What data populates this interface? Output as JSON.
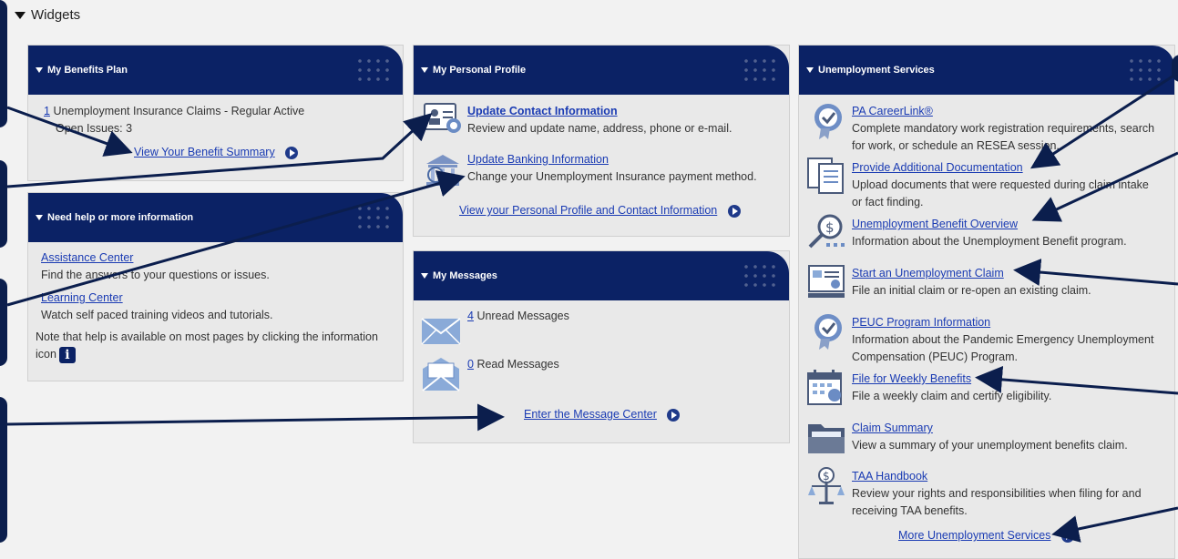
{
  "widgets_title": "Widgets",
  "benefits": {
    "title": "My Benefits Plan",
    "claim_count": "1",
    "claim_text": "Unemployment Insurance Claims - Regular Active",
    "open_issues": "Open Issues: 3",
    "summary_link": "View Your Benefit Summary"
  },
  "help": {
    "title": "Need help or more information",
    "assist_link": "Assistance Center",
    "assist_desc": "Find the answers to your questions or issues.",
    "learn_link": "Learning Center",
    "learn_desc": "Watch self paced training videos and tutorials.",
    "note_line1": "Note that help is available on most pages by clicking the information",
    "note_line2": "icon"
  },
  "profile": {
    "title": "My Personal Profile",
    "contact_link": "Update Contact Information",
    "contact_desc": "Review and update name, address, phone or e-mail.",
    "bank_link": "Update Banking Information",
    "bank_desc": "Change your Unemployment Insurance payment method.",
    "view_link": "View your Personal Profile and Contact Information"
  },
  "messages": {
    "title": "My Messages",
    "unread_count": "4",
    "unread_text": "Unread Messages",
    "read_count": "0",
    "read_text": "Read Messages",
    "center_link": "Enter the Message Center"
  },
  "services": {
    "title": "Unemployment Services",
    "items": [
      {
        "label": "PA CareerLink®",
        "desc1": "Complete mandatory work registration requirements, search",
        "desc2": "for work, or schedule an RESEA session."
      },
      {
        "label": "Provide Additional Documentation",
        "desc1": "Upload documents that were requested during claim intake",
        "desc2": "or fact finding."
      },
      {
        "label": "Unemployment Benefit Overview",
        "desc1": "Information about the Unemployment Benefit program.",
        "desc2": ""
      },
      {
        "label": "Start an Unemployment Claim",
        "desc1": "File an initial claim or re-open an existing claim.",
        "desc2": ""
      },
      {
        "label": "PEUC Program Information",
        "desc1": "Information about the Pandemic Emergency Unemployment",
        "desc2": "Compensation (PEUC) Program."
      },
      {
        "label": "File for Weekly Benefits",
        "desc1": "File a weekly claim and certify eligibility.",
        "desc2": ""
      },
      {
        "label": "Claim Summary",
        "desc1": "View a summary of your unemployment benefits claim.",
        "desc2": ""
      },
      {
        "label": "TAA Handbook",
        "desc1": "Review your rights and responsibilities when filing for and",
        "desc2": "receiving TAA benefits."
      }
    ],
    "more_link": "More Unemployment Services"
  },
  "colors": {
    "header": "#0b2265",
    "link": "#1a3bb3",
    "panel": "#e9e9e9"
  }
}
